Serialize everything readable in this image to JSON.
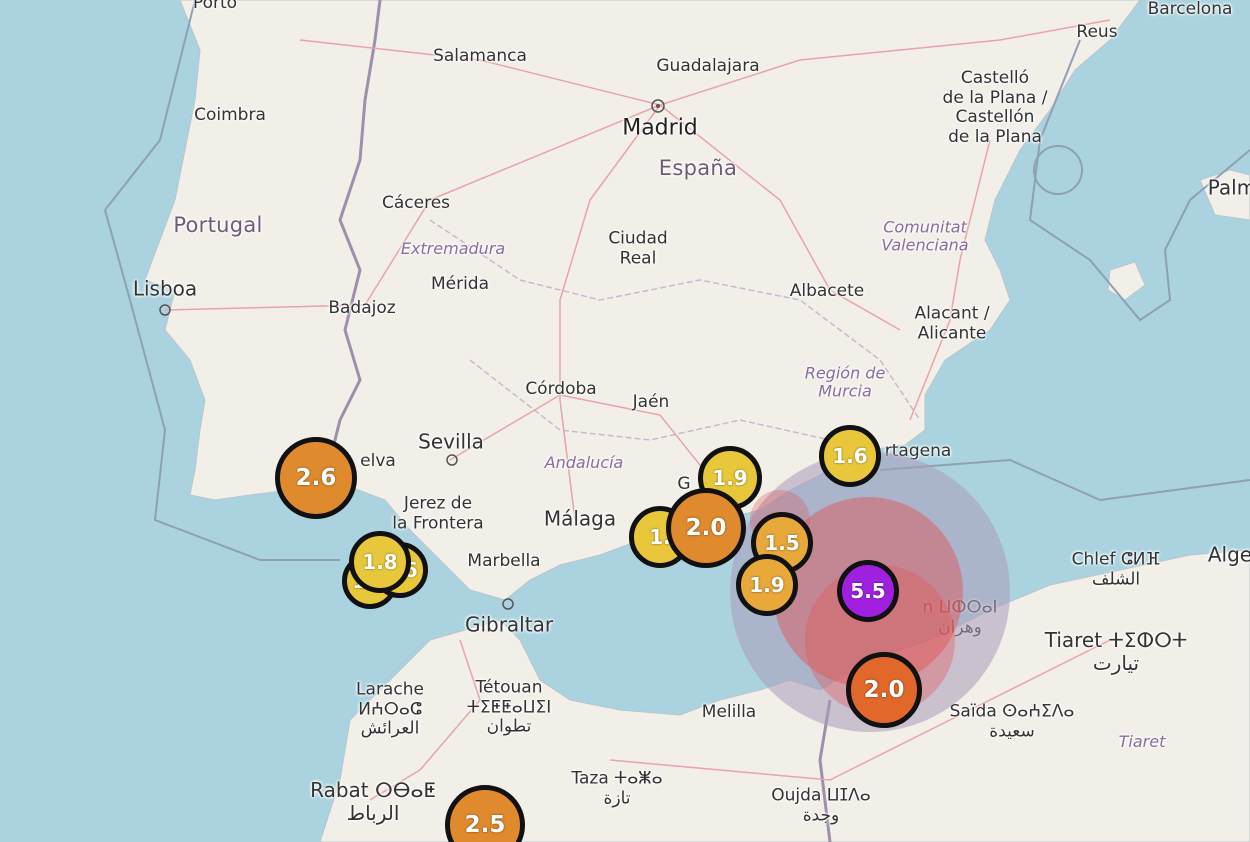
{
  "map": {
    "labels": {
      "porto": "Porto",
      "salamanca": "Salamanca",
      "guadalajara": "Guadalajara",
      "madrid": "Madrid",
      "espana": "España",
      "coimbra": "Coimbra",
      "castello": "Castelló\nde la Plana /\nCastellón\nde la Plana",
      "barcelona": "Barcelona",
      "reus": "Reus",
      "palma": "Palm",
      "portugal": "Portugal",
      "caceres": "Cáceres",
      "extremadura": "Extremadura",
      "ciudad_real": "Ciudad\nReal",
      "comunitat": "Comunitat\nValenciana",
      "lisboa": "Lisboa",
      "merida": "Mérida",
      "badajoz": "Badajoz",
      "albacete": "Albacete",
      "alacant": "Alacant /\nAlicante",
      "region_murcia": "Región de\nMurcia",
      "cordoba": "Córdoba",
      "jaen": "Jaén",
      "sevilla": "Sevilla",
      "huelva": "elva",
      "andalucia": "Andalucía",
      "cartagena": "rtagena",
      "jerez": "Jerez de\nla Frontera",
      "malaga": "Málaga",
      "granada_fragment": "G",
      "marbella": "Marbella",
      "gibraltar": "Gibraltar",
      "chlef": "Chlef ⵛⵍⴼ\nالشلف",
      "alger": "Alge",
      "oran": "n ⵡⵀⵔⴰⵏ\nوهران",
      "tiaret": "Tiaret ⵜⵉⵀⵔⵜ\nتيارت",
      "tiaret_region": "Tiaret",
      "larache": "Larache\nⵍⵄⵔⴰⵛ\nالعرائش",
      "tetouan": "Tétouan\nⵜⵉⵟⵟⴰⵡⵉⵏ\nتطوان",
      "melilla": "Melilla",
      "saida": "Saïda ⵙⴰⵄⵉⴷⴰ\nسعيدة",
      "rabat": "Rabat ⵔⴱⴰⵟ\nالرباط",
      "taza": "Taza ⵜⴰⵥⴰ\nتازة",
      "oujda": "Oujda ⵡⵊⴷⴰ\nوجدة"
    },
    "earthquakes": [
      {
        "mag": "2.6",
        "color": "#e08a2e"
      },
      {
        "mag": "1.6",
        "color": "#e8c83a"
      },
      {
        "mag": "1.6",
        "color": "#e8c83a"
      },
      {
        "mag": "1.8",
        "color": "#e8c83a"
      },
      {
        "mag": "1.9",
        "color": "#e8c83a"
      },
      {
        "mag": "1.",
        "color": "#e8c83a"
      },
      {
        "mag": "2.0",
        "color": "#e08a2e"
      },
      {
        "mag": "1.5",
        "color": "#e8a83a"
      },
      {
        "mag": "1.9",
        "color": "#e8a83a"
      },
      {
        "mag": "1.6",
        "color": "#e8c83a"
      },
      {
        "mag": "5.5",
        "color": "#a020e0"
      },
      {
        "mag": "2.0",
        "color": "#e2672a"
      },
      {
        "mag": "2.5",
        "color": "#e08a2e"
      }
    ],
    "colors": {
      "sea": "#aad3df",
      "land": "#f2efe9",
      "border": "#9e8fab",
      "halo_red": "#e25050",
      "halo_grey": "#a99ab8"
    }
  }
}
